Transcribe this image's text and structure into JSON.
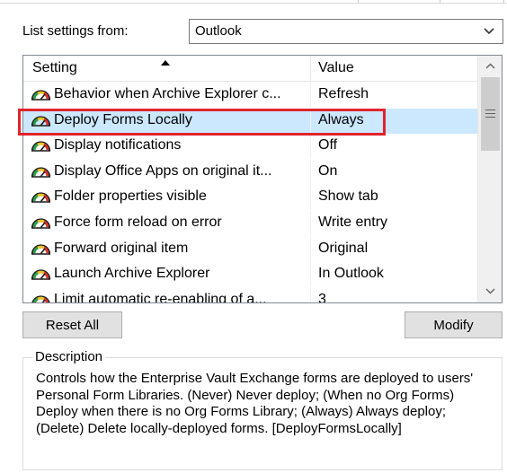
{
  "header": {
    "list_settings_label": "List settings from:",
    "list_settings_value": "Outlook"
  },
  "table": {
    "columns": [
      "Setting",
      "Value"
    ],
    "rows": [
      {
        "setting": "Behavior when Archive Explorer c...",
        "value": "Refresh",
        "selected": false
      },
      {
        "setting": "Deploy Forms Locally",
        "value": "Always",
        "selected": true
      },
      {
        "setting": "Display notifications",
        "value": "Off",
        "selected": false
      },
      {
        "setting": "Display Office Apps on original it...",
        "value": "On",
        "selected": false
      },
      {
        "setting": "Folder properties visible",
        "value": "Show tab",
        "selected": false
      },
      {
        "setting": "Force form reload on error",
        "value": "Write entry",
        "selected": false
      },
      {
        "setting": "Forward original item",
        "value": "Original",
        "selected": false
      },
      {
        "setting": "Launch Archive Explorer",
        "value": "In Outlook",
        "selected": false
      },
      {
        "setting": "Limit automatic re-enabling of a...",
        "value": "3",
        "selected": false
      }
    ],
    "row_icon": "gauge-icon"
  },
  "buttons": {
    "reset_all": "Reset All",
    "modify": "Modify"
  },
  "description": {
    "legend": "Description",
    "text": "Controls how the Enterprise Vault Exchange forms are deployed to users' Personal Form Libraries. (Never) Never deploy; (When no Org Forms) Deploy when there is no Org Forms Library; (Always) Always deploy; (Delete) Delete locally-deployed forms. [DeployFormsLocally]"
  },
  "colors": {
    "selection": "#cce8ff",
    "highlight_box": "#e0242b"
  }
}
